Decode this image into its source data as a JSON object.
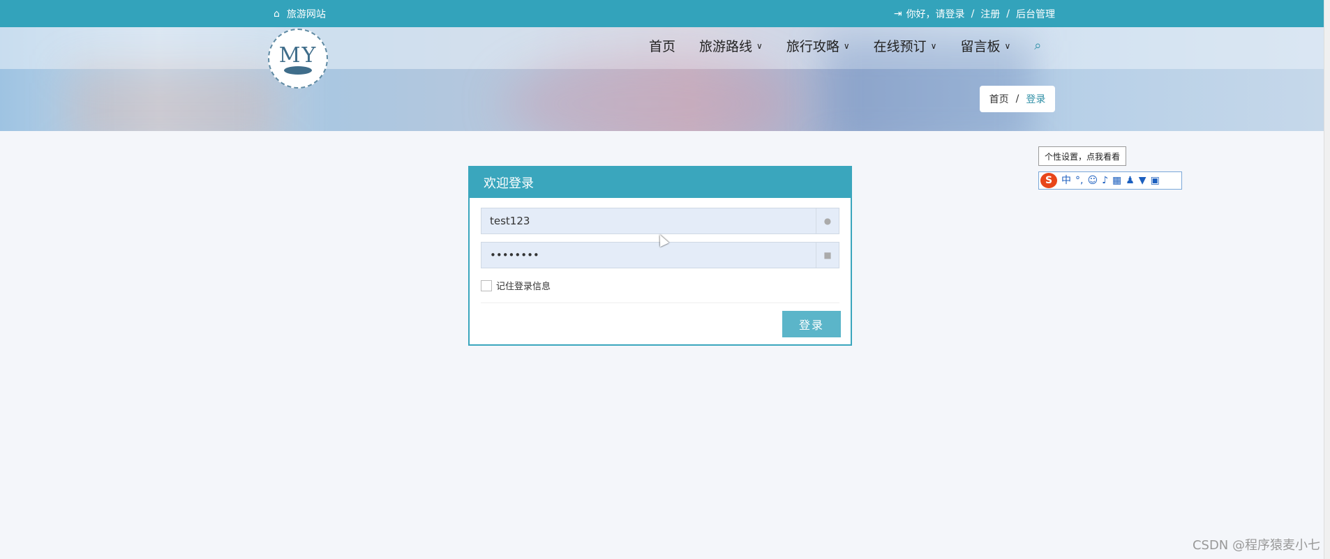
{
  "topbar": {
    "home_icon": "home-icon",
    "site_name": "旅游网站",
    "login_icon": "sign-in-icon",
    "greeting": "你好，请登录",
    "sep1": "/",
    "register": "注册",
    "sep2": "/",
    "admin": "后台管理"
  },
  "logo": {
    "text": "MY"
  },
  "nav": {
    "items": [
      {
        "label": "首页"
      },
      {
        "label": "旅游路线"
      },
      {
        "label": "旅行攻略"
      },
      {
        "label": "在线预订"
      },
      {
        "label": "留言板"
      }
    ],
    "chevron": "⌄",
    "search_icon": "search-icon"
  },
  "breadcrumb": {
    "home": "首页",
    "separator": "/",
    "current": "登录"
  },
  "login": {
    "title": "欢迎登录",
    "username_value": "test123",
    "password_value": "••••••••",
    "remember_label": "记住登录信息",
    "button_label": "登录"
  },
  "ime": {
    "tooltip": "个性设置，点我看看",
    "logo": "S",
    "mode": "中",
    "punct": "°,"
  },
  "watermark": "CSDN @程序猿麦小七",
  "colors": {
    "accent": "#33a3bb",
    "button": "#5bb5c9"
  }
}
